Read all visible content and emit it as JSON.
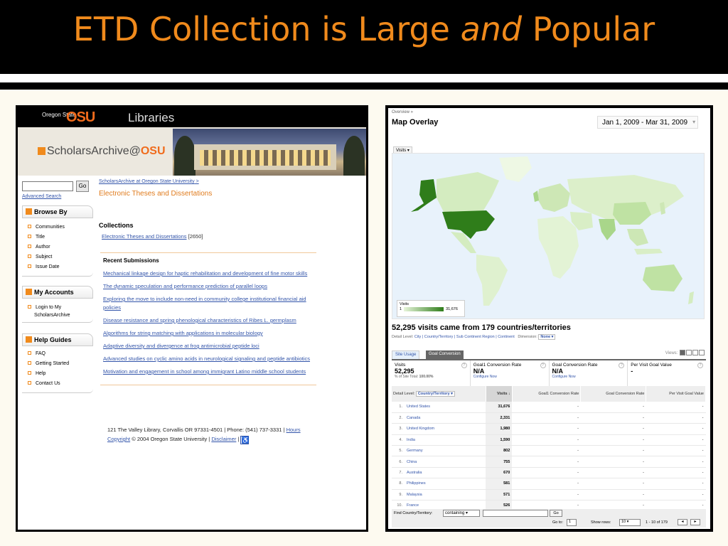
{
  "slide": {
    "title_pre": "ETD Collection is Large ",
    "title_em": "and",
    "title_post": " Popular"
  },
  "scholars": {
    "osu_small": "Oregon State",
    "osu_mark": "OSU",
    "libraries": "Libraries",
    "logo_text": "ScholarsArchive@",
    "logo_mark": "OSU",
    "go_label": "Go",
    "advanced_search": "Advanced Search",
    "breadcrumb": "ScholarsArchive at Oregon State University",
    "breadcrumb_sep": ">",
    "page_title": "Electronic Theses and Dissertations",
    "browse_by": {
      "heading": "Browse By",
      "items": [
        "Communities",
        "Title",
        "Author",
        "Subject",
        "Issue Date"
      ]
    },
    "my_accounts": {
      "heading": "My Accounts",
      "items": [
        "Login to My",
        "ScholarsArchive"
      ]
    },
    "help_guides": {
      "heading": "Help Guides",
      "items": [
        "FAQ",
        "Getting Started",
        "Help",
        "Contact Us"
      ]
    },
    "collections_heading": "Collections",
    "collection_link": "Electronic Theses and Dissertations",
    "collection_count": "[2650]",
    "recent_heading": "Recent Submissions",
    "recent_items": [
      "Mechanical linkage design for haptic rehabilitation and development of fine motor skills",
      "The dynamic speculation and performance prediction of parallel loops",
      "Exploring the move to include non-need in community college institutional financial aid policies",
      "Disease resistance and spring phenological characteristics of Ribes L. germplasm",
      "Algorithms for string matching with applications in molecular biology",
      "Adaptive diversity and divergence at frog antimicrobial peptide loci",
      "Advanced studies on cyclic amino acids in neurological signaling and peptide antibiotics",
      "Motivation and engagement in school among immigrant Latino middle school students"
    ],
    "footer_address": "121 The Valley Library, Corvallis OR 97331-4501 | Phone: (541) 737-3331 |",
    "footer_hours": "Hours",
    "footer_copyright_link": "Copyright",
    "footer_copyright_text": "© 2004 Oregon State University |",
    "footer_disclaimer": "Disclaimer",
    "footer_pipe": "|"
  },
  "analytics": {
    "crumb": "Overview »",
    "title": "Map Overlay",
    "date_range": "Jan 1, 2009 - Mar 31, 2009",
    "metric_select": "Visits",
    "legend_label": "Visits",
    "legend_min": "1",
    "legend_max": "31,676",
    "headline": "52,295 visits came from 179 countries/territories",
    "detail_prefix": "Detail Level:",
    "detail_links": "City | Country/Territory | Sub Continent Region | Continent",
    "dimension_label": "Dimension:",
    "dimension_value": "None",
    "tab_usage": "Site Usage",
    "tab_goal": "Goal Conversion",
    "views_label": "Views:",
    "summary": [
      {
        "label": "Visits",
        "value": "52,295",
        "sub_text": "% of Site Total: ",
        "sub_bold": "100.00%"
      },
      {
        "label": "Goal1 Conversion Rate",
        "value": "N/A",
        "sub_link": "Configure Now"
      },
      {
        "label": "Goal Conversion Rate",
        "value": "N/A",
        "sub_link": "Configure Now"
      },
      {
        "label": "Per Visit Goal Value",
        "value": "-"
      }
    ],
    "table": {
      "detail_label": "Detail Level:",
      "detail_value": "Country/Territory",
      "headers": [
        "Visits ↓",
        "Goal1 Conversion Rate",
        "Goal Conversion Rate",
        "Per Visit Goal Value"
      ],
      "rows": [
        {
          "num": "1.",
          "country": "United States",
          "visits": "31,676",
          "g1": "-",
          "g": "-",
          "pv": "-"
        },
        {
          "num": "2.",
          "country": "Canada",
          "visits": "2,331",
          "g1": "-",
          "g": "-",
          "pv": "-"
        },
        {
          "num": "3.",
          "country": "United Kingdom",
          "visits": "1,980",
          "g1": "-",
          "g": "-",
          "pv": "-"
        },
        {
          "num": "4.",
          "country": "India",
          "visits": "1,590",
          "g1": "-",
          "g": "-",
          "pv": "-"
        },
        {
          "num": "5.",
          "country": "Germany",
          "visits": "802",
          "g1": "-",
          "g": "-",
          "pv": "-"
        },
        {
          "num": "6.",
          "country": "China",
          "visits": "755",
          "g1": "-",
          "g": "-",
          "pv": "-"
        },
        {
          "num": "7.",
          "country": "Australia",
          "visits": "670",
          "g1": "-",
          "g": "-",
          "pv": "-"
        },
        {
          "num": "8.",
          "country": "Philippines",
          "visits": "581",
          "g1": "-",
          "g": "-",
          "pv": "-"
        },
        {
          "num": "9.",
          "country": "Malaysia",
          "visits": "571",
          "g1": "-",
          "g": "-",
          "pv": "-"
        },
        {
          "num": "10.",
          "country": "France",
          "visits": "526",
          "g1": "-",
          "g": "-",
          "pv": "-"
        }
      ]
    },
    "find_label": "Find Country/Territory:",
    "find_select": "containing",
    "find_go": "Go",
    "goto_label": "Go to:",
    "goto_value": "1",
    "show_rows_label": "Show rows:",
    "show_rows_value": "10",
    "range_text": "1 - 10 of 179"
  },
  "colors": {
    "title_orange": "#f08a1c",
    "link_blue": "#3355aa",
    "map_dark_green": "#2f7d1a",
    "map_light_green": "#d4ecc0"
  }
}
